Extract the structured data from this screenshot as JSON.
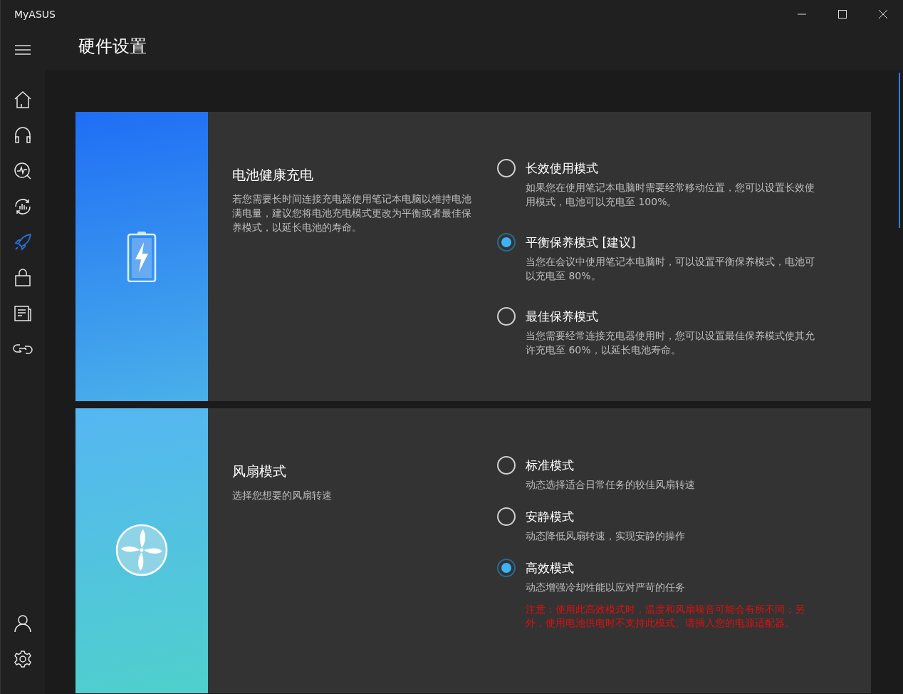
{
  "window": {
    "title": "MyASUS"
  },
  "page": {
    "title": "硬件设置"
  },
  "sidebar": {
    "items": [
      {
        "kind": "home",
        "selected": false
      },
      {
        "kind": "headset",
        "selected": false
      },
      {
        "kind": "diagnosis",
        "selected": false
      },
      {
        "kind": "update",
        "selected": false
      },
      {
        "kind": "rocket",
        "selected": true
      },
      {
        "kind": "bag",
        "selected": false
      },
      {
        "kind": "news",
        "selected": false
      },
      {
        "kind": "link",
        "selected": false
      }
    ],
    "bottom_items": [
      {
        "kind": "user"
      },
      {
        "kind": "settings"
      }
    ]
  },
  "sections": [
    {
      "kind": "battery",
      "title": "电池健康充电",
      "description": "若您需要长时间连接充电器使用笔记本电脑以维持电池满电量，建议您将电池充电模式更改为平衡或者最佳保养模式，以延长电池的寿命。",
      "options": [
        {
          "label": "长效使用模式",
          "description": "如果您在使用笔记本电脑时需要经常移动位置，您可以设置长效使用模式，电池可以充电至 100%。",
          "selected": false
        },
        {
          "label": "平衡保养模式 [建议]",
          "description": "当您在会议中使用笔记本电脑时，可以设置平衡保养模式，电池可以充电至 80%。",
          "selected": true
        },
        {
          "label": "最佳保养模式",
          "description": "当您需要经常连接充电器使用时，您可以设置最佳保养模式使其允许充电至 60%，以延长电池寿命。",
          "selected": false
        }
      ]
    },
    {
      "kind": "fan",
      "title": "风扇模式",
      "description": "选择您想要的风扇转速",
      "options": [
        {
          "label": "标准模式",
          "description": "动态选择适合日常任务的较佳风扇转速",
          "selected": false
        },
        {
          "label": "安静模式",
          "description": "动态降低风扇转速，实现安静的操作",
          "selected": false
        },
        {
          "label": "高效模式",
          "description": "动态增强冷却性能以应对严苛的任务",
          "warning": "注意：使用此高效模式时，温度和风扇噪音可能会有所不同；另外，使用电池供电时不支持此模式。请插入您的电源适配器。",
          "selected": true
        }
      ]
    }
  ]
}
